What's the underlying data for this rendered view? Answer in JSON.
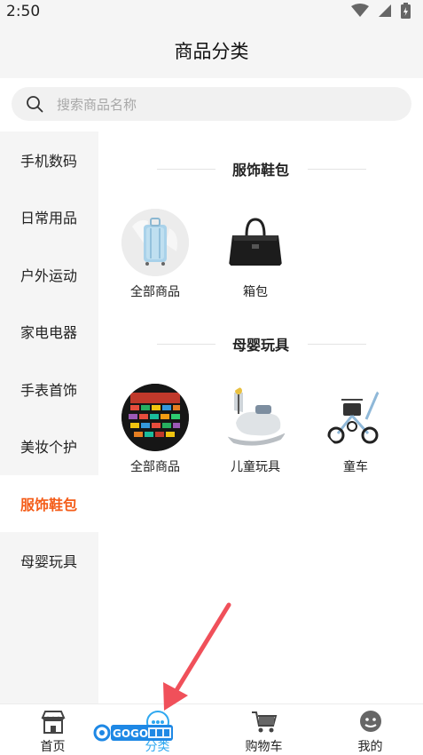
{
  "status": {
    "time": "2:50",
    "icons": [
      "wifi-icon",
      "signal-icon",
      "battery-icon"
    ]
  },
  "header": {
    "title": "商品分类"
  },
  "search": {
    "placeholder": "搜索商品名称",
    "icon": "search-icon"
  },
  "sidebar": {
    "items": [
      {
        "label": "手机数码"
      },
      {
        "label": "日常用品"
      },
      {
        "label": "户外运动"
      },
      {
        "label": "家电电器"
      },
      {
        "label": "手表首饰"
      },
      {
        "label": "美妆个护"
      },
      {
        "label": "服饰鞋包"
      },
      {
        "label": "母婴玩具"
      }
    ],
    "active_index": 6
  },
  "sections": [
    {
      "title": "服饰鞋包",
      "items": [
        {
          "label": "全部商品",
          "icon": "suitcase-image"
        },
        {
          "label": "箱包",
          "icon": "handbag-image"
        }
      ]
    },
    {
      "title": "母婴玩具",
      "items": [
        {
          "label": "全部商品",
          "icon": "toycars-image"
        },
        {
          "label": "儿童玩具",
          "icon": "rocking-horse-image"
        },
        {
          "label": "童车",
          "icon": "tricycle-image"
        }
      ]
    }
  ],
  "tabbar": {
    "tabs": [
      {
        "label": "首页",
        "icon": "store-icon"
      },
      {
        "label": "分类",
        "icon": "category-icon"
      },
      {
        "label": "购物车",
        "icon": "cart-icon"
      },
      {
        "label": "我的",
        "icon": "profile-icon"
      }
    ],
    "active_index": 1
  },
  "colors": {
    "accent": "#f45c18",
    "tab_active": "#2fa8f0",
    "arrow": "#f0505a"
  },
  "watermark": {
    "text": "GOGO手游网",
    "icon": "gogo-watermark-logo"
  }
}
